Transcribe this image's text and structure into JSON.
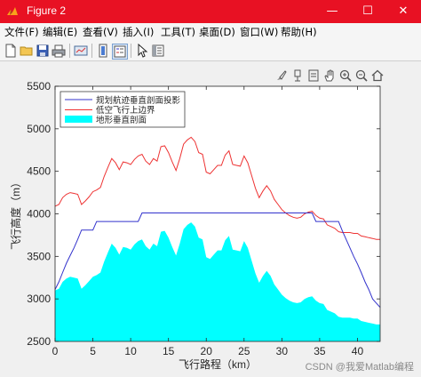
{
  "window": {
    "title": "Figure 2",
    "minimize": "—",
    "maximize": "☐",
    "close": "✕"
  },
  "menu": [
    {
      "label": "文件(F)"
    },
    {
      "label": "编辑(E)"
    },
    {
      "label": "查看(V)"
    },
    {
      "label": "插入(I)"
    },
    {
      "label": "工具(T)"
    },
    {
      "label": "桌面(D)"
    },
    {
      "label": "窗口(W)"
    },
    {
      "label": "帮助(H)"
    }
  ],
  "toolbar_icons": [
    "new-figure-icon",
    "open-file-icon",
    "save-icon",
    "print-icon",
    "link-plot-icon",
    "colorbar-icon",
    "legend-icon",
    "pointer-icon",
    "property-inspector-icon"
  ],
  "axes_toolbar_icons": [
    "brush-icon",
    "data-tips-icon",
    "save-axes-icon",
    "pan-icon",
    "zoom-in-icon",
    "zoom-out-icon",
    "home-icon"
  ],
  "watermark": "CSDN @我爱Matlab编程",
  "chart_data": {
    "type": "area",
    "xlabel": "飞行路程（km）",
    "ylabel": "飞行高度（m）",
    "xlim": [
      0,
      43
    ],
    "ylim": [
      2500,
      5500
    ],
    "xticks": [
      0,
      5,
      10,
      15,
      20,
      25,
      30,
      35,
      40
    ],
    "yticks": [
      2500,
      3000,
      3500,
      4000,
      4500,
      5000,
      5500
    ],
    "legend_position": "top-left",
    "colors": {
      "terrain": "#00ffff",
      "planned": "#3333cc",
      "upper": "#ee3333"
    },
    "x": [
      0,
      0.5,
      1,
      1.5,
      2,
      2.5,
      3,
      3.5,
      4,
      4.5,
      5,
      5.5,
      6,
      6.5,
      7,
      7.5,
      8,
      8.5,
      9,
      9.5,
      10,
      10.5,
      11,
      11.5,
      12,
      12.5,
      13,
      13.5,
      14,
      14.5,
      15,
      15.5,
      16,
      16.5,
      17,
      17.5,
      18,
      18.5,
      19,
      19.5,
      20,
      20.5,
      21,
      21.5,
      22,
      22.5,
      23,
      23.5,
      24,
      24.5,
      25,
      25.5,
      26,
      26.5,
      27,
      27.5,
      28,
      28.5,
      29,
      29.5,
      30,
      30.5,
      31,
      31.5,
      32,
      32.5,
      33,
      33.5,
      34,
      34.5,
      35,
      35.5,
      36,
      36.5,
      37,
      37.5,
      38,
      38.5,
      39,
      39.5,
      40,
      40.5,
      41,
      41.5,
      42,
      42.5,
      43
    ],
    "series": [
      {
        "name": "规划航迹垂直剖面投影",
        "values": [
          3110,
          3200,
          3310,
          3420,
          3510,
          3600,
          3700,
          3810,
          3810,
          3810,
          3810,
          3910,
          3910,
          3910,
          3910,
          3910,
          3910,
          3910,
          3910,
          3910,
          3910,
          3910,
          3910,
          4010,
          4010,
          4010,
          4010,
          4010,
          4010,
          4010,
          4010,
          4010,
          4010,
          4010,
          4010,
          4010,
          4010,
          4010,
          4010,
          4010,
          4010,
          4010,
          4010,
          4010,
          4010,
          4010,
          4010,
          4010,
          4010,
          4010,
          4010,
          4010,
          4010,
          4010,
          4010,
          4010,
          4010,
          4010,
          4010,
          4010,
          4010,
          4010,
          4010,
          4010,
          4010,
          4010,
          4010,
          4010,
          4010,
          3910,
          3910,
          3910,
          3910,
          3910,
          3910,
          3910,
          3800,
          3700,
          3600,
          3500,
          3410,
          3310,
          3200,
          3110,
          3000,
          2950,
          2900
        ]
      },
      {
        "name": "低空飞行上边界",
        "values": [
          4090,
          4110,
          4190,
          4230,
          4250,
          4240,
          4230,
          4110,
          4150,
          4200,
          4260,
          4280,
          4310,
          4440,
          4550,
          4650,
          4600,
          4520,
          4610,
          4600,
          4580,
          4640,
          4680,
          4700,
          4620,
          4580,
          4650,
          4620,
          4790,
          4800,
          4720,
          4610,
          4510,
          4650,
          4820,
          4870,
          4900,
          4850,
          4720,
          4700,
          4490,
          4470,
          4520,
          4570,
          4570,
          4690,
          4740,
          4580,
          4570,
          4560,
          4680,
          4600,
          4450,
          4300,
          4190,
          4270,
          4330,
          4270,
          4170,
          4110,
          4050,
          4010,
          3980,
          3960,
          3950,
          3960,
          4000,
          4020,
          4030,
          3980,
          3950,
          3940,
          3870,
          3850,
          3830,
          3790,
          3780,
          3780,
          3780,
          3770,
          3770,
          3740,
          3730,
          3720,
          3710,
          3700,
          3700
        ]
      },
      {
        "name": "地形垂直剖面",
        "values": [
          3100,
          3120,
          3200,
          3240,
          3260,
          3250,
          3240,
          3120,
          3160,
          3210,
          3260,
          3280,
          3310,
          3440,
          3550,
          3650,
          3600,
          3520,
          3610,
          3600,
          3580,
          3640,
          3680,
          3700,
          3620,
          3580,
          3650,
          3620,
          3790,
          3800,
          3720,
          3610,
          3510,
          3650,
          3820,
          3870,
          3900,
          3850,
          3720,
          3700,
          3490,
          3470,
          3520,
          3570,
          3570,
          3690,
          3740,
          3580,
          3570,
          3560,
          3680,
          3600,
          3450,
          3300,
          3190,
          3270,
          3330,
          3270,
          3170,
          3110,
          3050,
          3010,
          2980,
          2960,
          2950,
          2960,
          3000,
          3020,
          3030,
          2980,
          2950,
          2940,
          2870,
          2850,
          2830,
          2790,
          2780,
          2780,
          2780,
          2770,
          2770,
          2740,
          2730,
          2720,
          2710,
          2700,
          2700
        ]
      }
    ]
  }
}
